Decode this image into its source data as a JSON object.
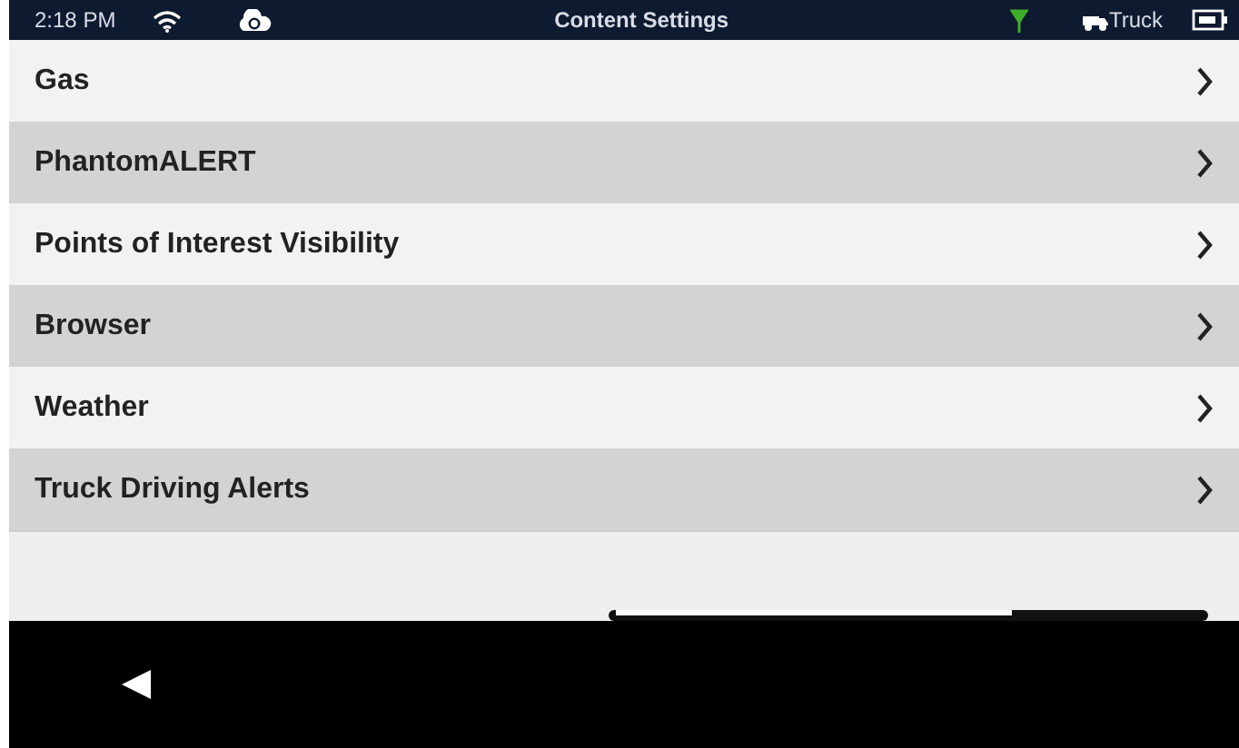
{
  "status_bar": {
    "time": "2:18 PM",
    "title": "Content Settings",
    "profile": "Truck"
  },
  "items": [
    {
      "label": "Gas"
    },
    {
      "label": "PhantomALERT"
    },
    {
      "label": "Points of Interest Visibility"
    },
    {
      "label": "Browser"
    },
    {
      "label": "Weather"
    },
    {
      "label": "Truck Driving Alerts"
    }
  ]
}
